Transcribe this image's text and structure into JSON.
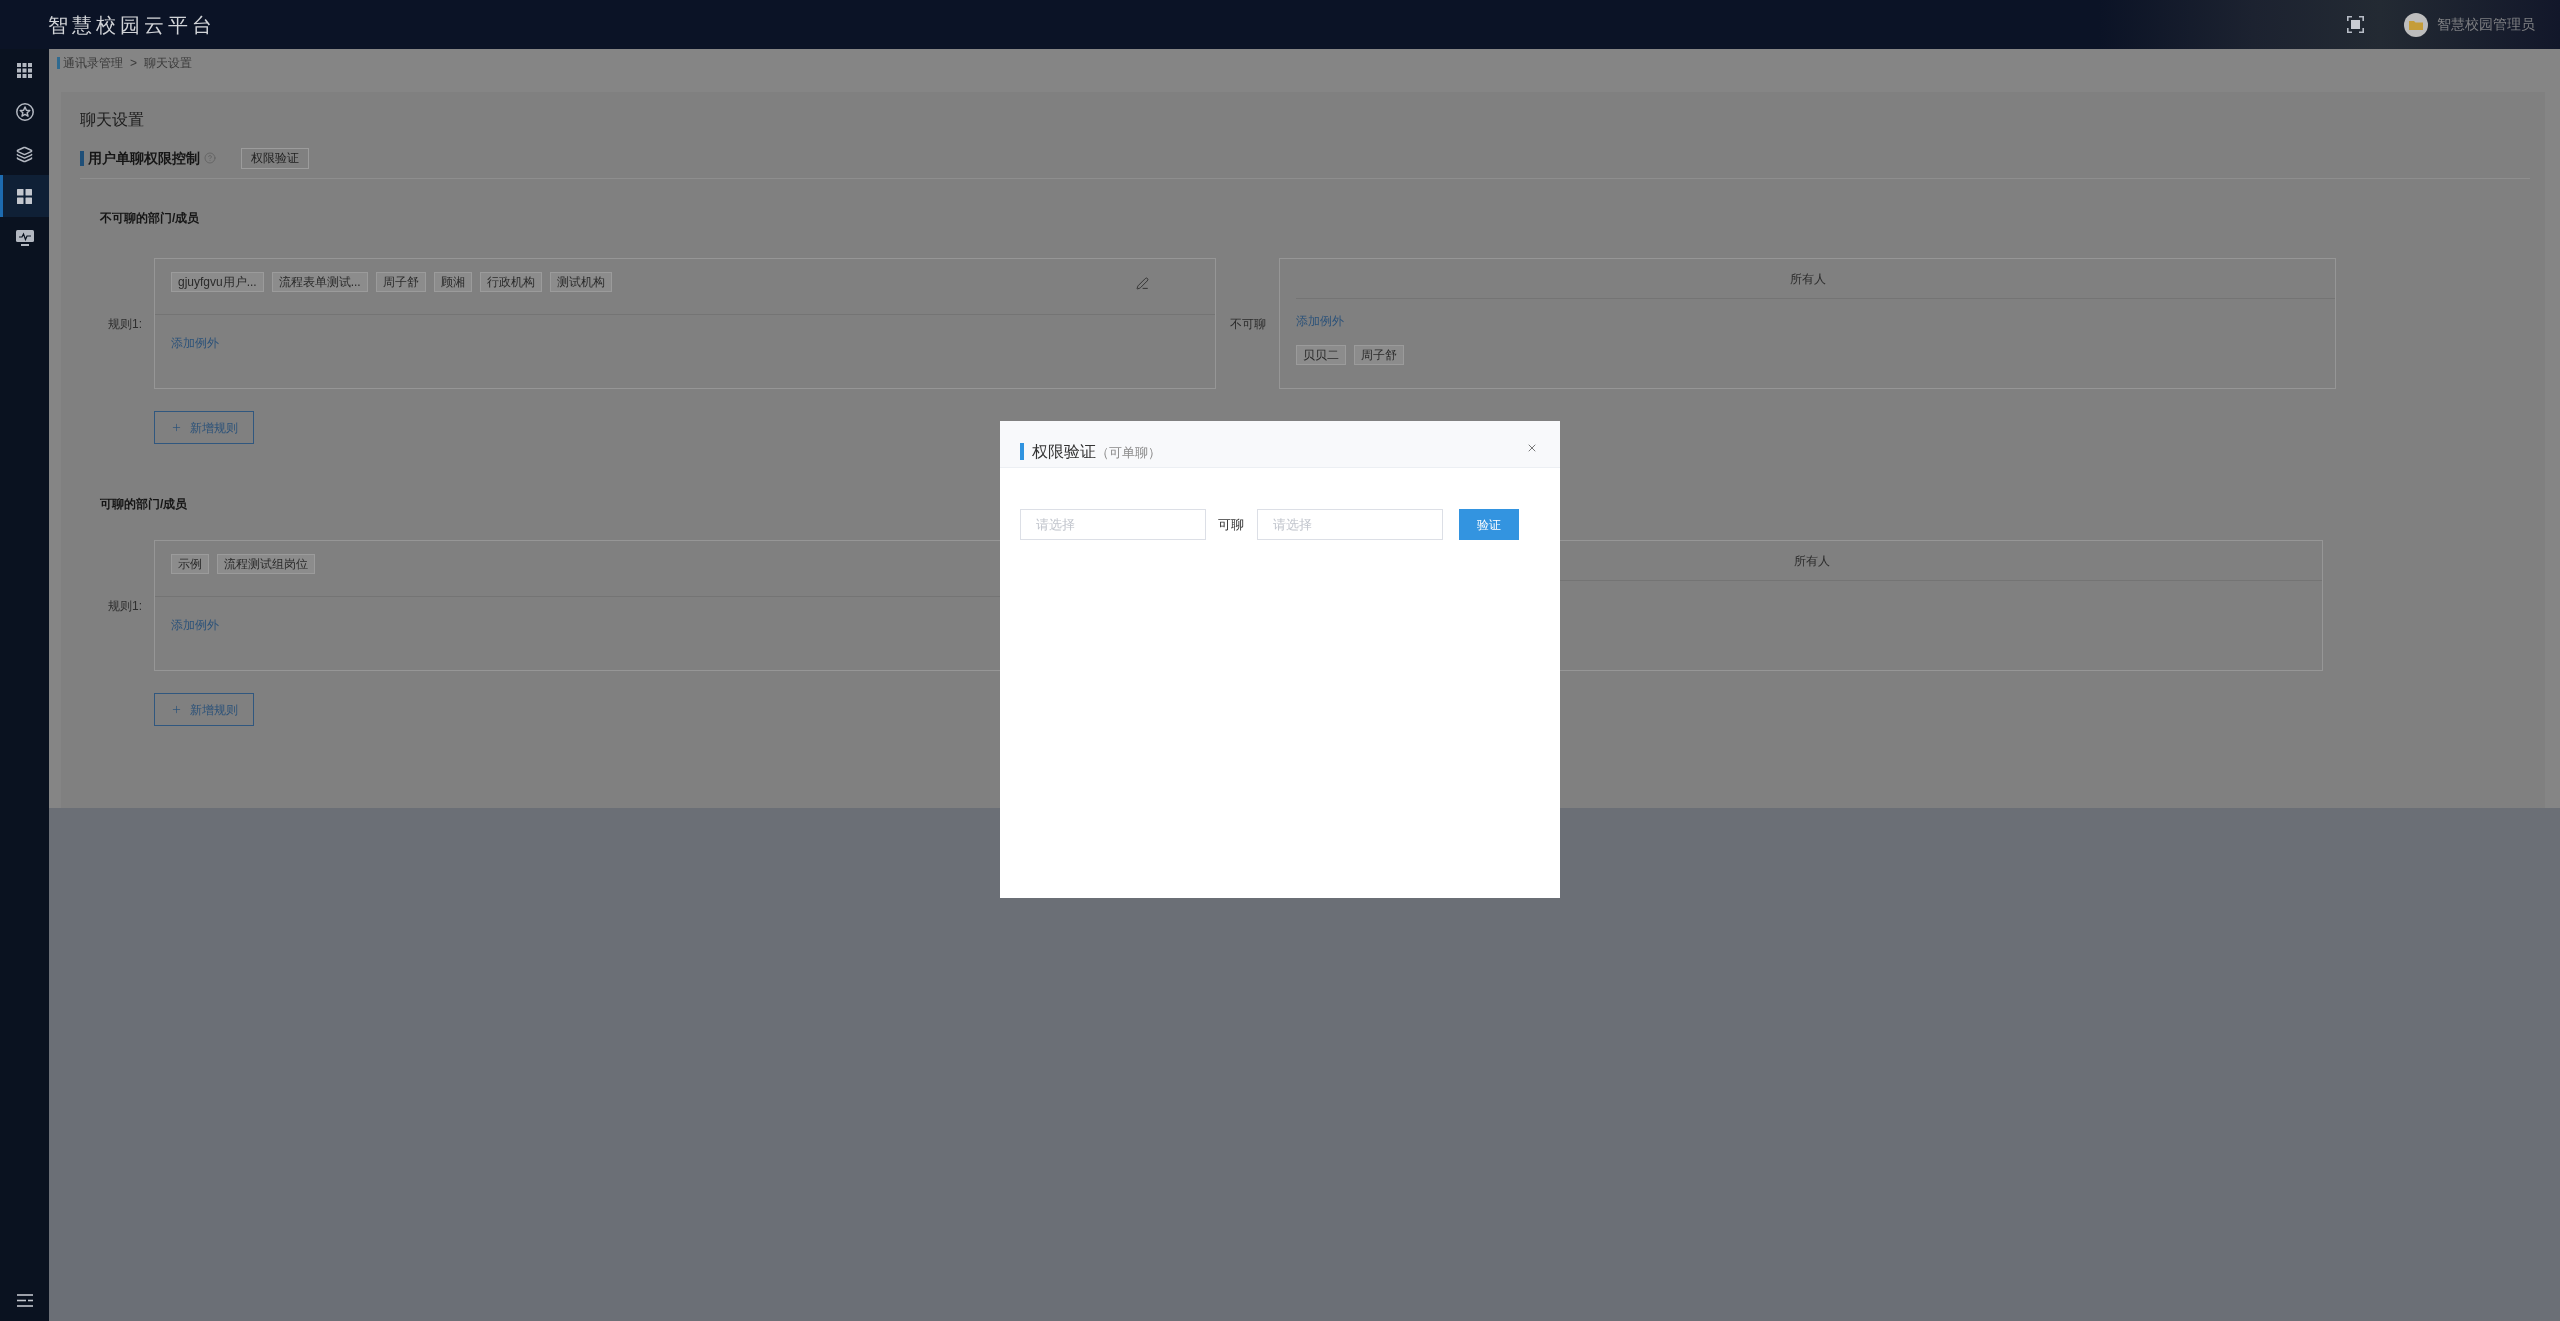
{
  "header": {
    "title": "智慧校园云平台",
    "user": "智慧校园管理员"
  },
  "sidebar": {
    "items": [
      {
        "kind": "apps",
        "selected": false
      },
      {
        "kind": "star",
        "selected": false
      },
      {
        "kind": "layers",
        "selected": false
      },
      {
        "kind": "tiles",
        "selected": true
      },
      {
        "kind": "monitor",
        "selected": false
      }
    ]
  },
  "breadcrumb": {
    "items": [
      "通讯录管理",
      "聊天设置"
    ],
    "separator": ">"
  },
  "page": {
    "title": "聊天设置",
    "section_title": "用户单聊权限控制",
    "verify_button": "权限验证"
  },
  "groups": [
    {
      "heading": "不可聊的部门/成员",
      "rules": [
        {
          "label": "规则1:",
          "tags": [
            "gjuyfgvu用户...",
            "流程表单测试...",
            "周子舒",
            "顾湘",
            "行政机构",
            "测试机构"
          ],
          "editable": true,
          "add_exception": "添加例外",
          "relation": "不可聊",
          "target": {
            "heading": "所有人",
            "add_exception": "添加例外",
            "tags": [
              "贝贝二",
              "周子舒"
            ]
          }
        }
      ],
      "add_rule": "新增规则"
    },
    {
      "heading": "可聊的部门/成员",
      "rules": [
        {
          "label": "规则1:",
          "tags": [
            "示例",
            "流程测试组岗位"
          ],
          "add_exception": "添加例外",
          "target": {
            "heading": "所有人"
          }
        }
      ],
      "add_rule": "新增规则"
    }
  ],
  "modal": {
    "title": "权限验证",
    "subtitle": "（可单聊）",
    "from_placeholder": "请选择",
    "relation": "可聊",
    "to_placeholder": "请选择",
    "button": "验证"
  }
}
